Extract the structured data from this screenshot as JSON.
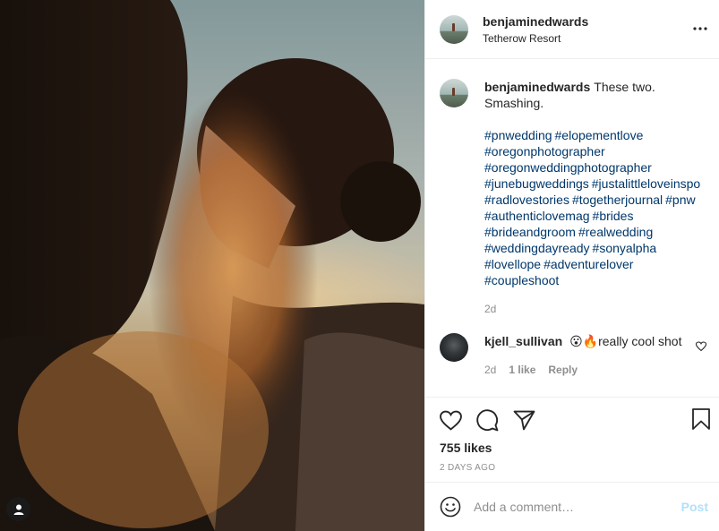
{
  "post": {
    "author": "benjaminedwards",
    "location": "Tetherow Resort",
    "caption": {
      "username": "benjaminedwards",
      "text": "These two. Smashing.",
      "hashtags": [
        "#pnwedding",
        "#elopementlove",
        "#oregonphotographer",
        "#oregonweddingphotographer",
        "#junebugweddings",
        "#justalittleloveinspo",
        "#radlovestories",
        "#togetherjournal",
        "#pnw",
        "#authenticlovemag",
        "#brides",
        "#brideandgroom",
        "#realwedding",
        "#weddingdayready",
        "#sonyalpha",
        "#lovellope",
        "#adventurelover",
        "#coupleshoot"
      ],
      "age": "2d"
    },
    "comments": [
      {
        "username": "kjell_sullivan",
        "text": "😮🔥really cool shot",
        "age": "2d",
        "likes": "1 like",
        "reply_label": "Reply"
      }
    ],
    "likes_text": "755 likes",
    "timestamp": "2 DAYS AGO",
    "add_comment": {
      "placeholder": "Add a comment…",
      "post_label": "Post"
    }
  },
  "icons": {
    "more": "more-horizontal-icon",
    "like": "heart-icon",
    "comment": "comment-icon",
    "share": "paper-plane-icon",
    "save": "bookmark-icon",
    "emoji": "emoji-icon",
    "tagged_user": "user-tag-icon"
  },
  "colors": {
    "link": "#00376b",
    "muted": "#8e8e8e",
    "post_disabled": "#b2dffc",
    "border": "#efefef"
  }
}
